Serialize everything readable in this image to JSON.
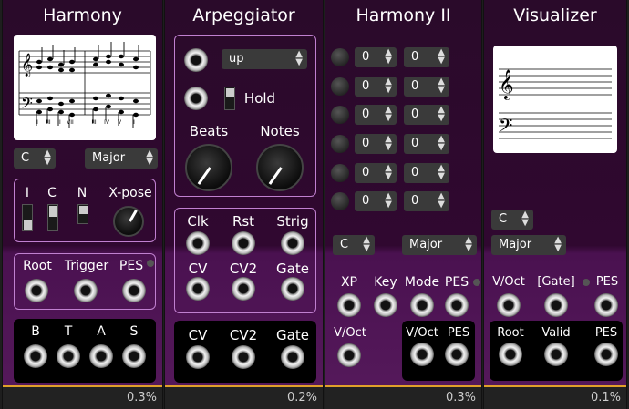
{
  "m1": {
    "title": "Harmony",
    "key": "C",
    "mode": "Major",
    "switch_labels": [
      "I",
      "C",
      "N",
      "X-pose"
    ],
    "jacks1": [
      "Root",
      "Trigger",
      "PES"
    ],
    "outs": [
      "B",
      "T",
      "A",
      "S"
    ],
    "cpu": "0.3%",
    "roman": [
      "I",
      "III",
      "II",
      "VII",
      "III",
      "IV",
      "V",
      "I"
    ]
  },
  "m2": {
    "title": "Arpeggiator",
    "mode": "up",
    "hold": "Hold",
    "knobs": [
      "Beats",
      "Notes"
    ],
    "row1": [
      "Clk",
      "Rst",
      "Strig"
    ],
    "row2": [
      "CV",
      "CV2",
      "Gate"
    ],
    "outs": [
      "CV",
      "CV2",
      "Gate"
    ],
    "cpu": "0.2%"
  },
  "m3": {
    "title": "Harmony II",
    "vals": [
      "0",
      "0",
      "0",
      "0",
      "0",
      "0",
      "0",
      "0",
      "0",
      "0",
      "0",
      "0"
    ],
    "key": "C",
    "mode": "Major",
    "row1": [
      "XP",
      "Key",
      "Mode",
      "PES"
    ],
    "voct": "V/Oct",
    "outs": [
      "V/Oct",
      "PES"
    ],
    "cpu": "0.3%"
  },
  "m4": {
    "title": "Visualizer",
    "key": "C",
    "mode": "Major",
    "row1": [
      "V/Oct",
      "[Gate]",
      "PES"
    ],
    "outs": [
      "Root",
      "Valid",
      "PES"
    ],
    "cpu": "0.1%"
  }
}
